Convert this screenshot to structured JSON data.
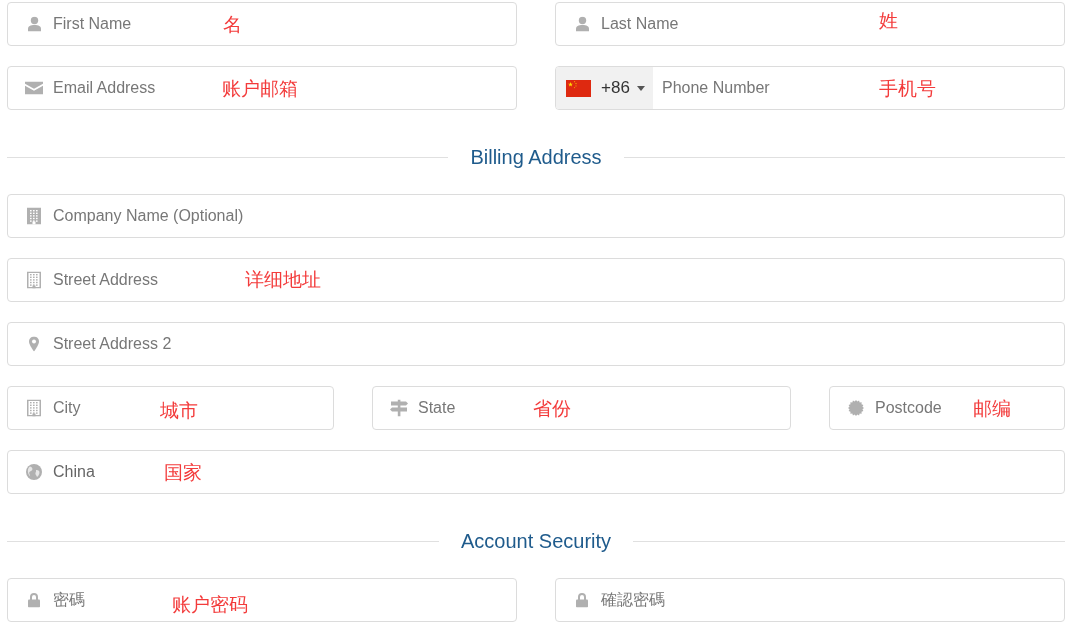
{
  "form": [
    {
      "kind": "row",
      "fields": [
        {
          "kind": "name",
          "placeholder": "First Name",
          "annotation": "名"
        },
        {
          "kind": "name",
          "placeholder": "Last Name",
          "annotation": "姓"
        }
      ]
    },
    {
      "kind": "row",
      "fields": [
        {
          "kind": "email",
          "placeholder": "Email Address",
          "annotation": "账户邮箱"
        },
        {
          "kind": "phone",
          "dial_code": "+86",
          "placeholder": "Phone Number",
          "annotation": "手机号"
        }
      ]
    },
    {
      "kind": "heading",
      "title": "Billing Address"
    },
    {
      "kind": "row",
      "fields": [
        {
          "kind": "company",
          "placeholder": "Company Name (Optional)"
        }
      ]
    },
    {
      "kind": "row",
      "fields": [
        {
          "kind": "street",
          "placeholder": "Street Address",
          "annotation": "详细地址"
        }
      ]
    },
    {
      "kind": "row",
      "fields": [
        {
          "kind": "address2",
          "placeholder": "Street Address 2"
        }
      ]
    },
    {
      "kind": "row",
      "fields": [
        {
          "kind": "city",
          "placeholder": "City",
          "annotation": "城市"
        },
        {
          "kind": "state",
          "placeholder": "State",
          "annotation": "省份"
        },
        {
          "kind": "postcode",
          "placeholder": "Postcode",
          "annotation": "邮编"
        }
      ]
    },
    {
      "kind": "row",
      "fields": [
        {
          "kind": "country",
          "value": "China",
          "annotation": "国家"
        }
      ]
    },
    {
      "kind": "heading",
      "title": "Account Security"
    },
    {
      "kind": "row",
      "fields": [
        {
          "kind": "password",
          "placeholder": "密碼",
          "annotation": "账户密码"
        },
        {
          "kind": "password",
          "placeholder": "確認密碼"
        }
      ]
    }
  ]
}
